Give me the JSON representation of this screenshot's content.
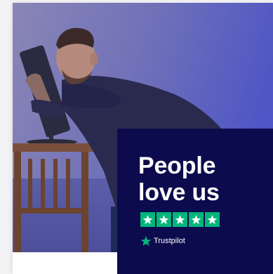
{
  "hero": {
    "image_alt": "man hugging computer monitor",
    "overlay_bg": "#0c0b4d"
  },
  "headline": {
    "line1": "People",
    "line2": "love us"
  },
  "rating": {
    "stars_filled": 5,
    "stars_total": 5,
    "star_color": "#00b67a",
    "star_icon": "star-icon"
  },
  "brand": {
    "name": "Trustpilot",
    "icon": "trustpilot-star-icon",
    "color": "#00b67a"
  }
}
